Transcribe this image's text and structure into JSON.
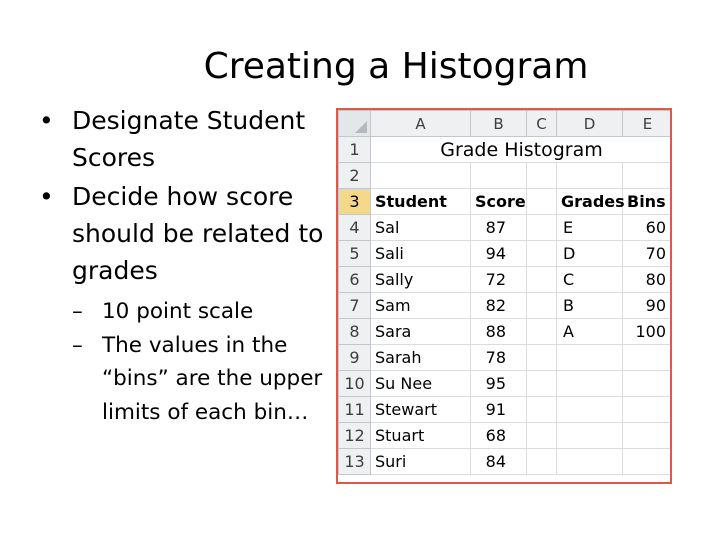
{
  "slide": {
    "title": "Creating a Histogram",
    "bullets": [
      {
        "text": "Designate Student Scores"
      },
      {
        "text": "Decide how score should be related to grades"
      }
    ],
    "sub_bullets": [
      {
        "text": "10 point scale"
      },
      {
        "text": "The values in the “bins” are the upper limits of each bin…"
      }
    ],
    "bullet_mark": "•",
    "sub_bullet_mark": "–"
  },
  "sheet": {
    "columns": [
      "A",
      "B",
      "C",
      "D",
      "E"
    ],
    "title": "Grade Histogram",
    "header_row": {
      "student": "Student",
      "score": "Score",
      "grades": "Grades",
      "bins": "Bins"
    },
    "row_numbers": [
      "1",
      "2",
      "3",
      "4",
      "5",
      "6",
      "7",
      "8",
      "9",
      "10",
      "11",
      "12",
      "13"
    ],
    "active_row": "3",
    "students": [
      {
        "name": "Sal",
        "score": "87"
      },
      {
        "name": "Sali",
        "score": "94"
      },
      {
        "name": "Sally",
        "score": "72"
      },
      {
        "name": "Sam",
        "score": "82"
      },
      {
        "name": "Sara",
        "score": "88"
      },
      {
        "name": "Sarah",
        "score": "78"
      },
      {
        "name": "Su Nee",
        "score": "95"
      },
      {
        "name": "Stewart",
        "score": "91"
      },
      {
        "name": "Stuart",
        "score": "68"
      },
      {
        "name": "Suri",
        "score": "84"
      }
    ],
    "grades": [
      {
        "grade": "E",
        "bin": "60"
      },
      {
        "grade": "D",
        "bin": "70"
      },
      {
        "grade": "C",
        "bin": "80"
      },
      {
        "grade": "B",
        "bin": "90"
      },
      {
        "grade": "A",
        "bin": "100"
      }
    ],
    "colors": {
      "border": "#e0584a",
      "active_row_header": "#f5d98b",
      "header_bg": "#eef0f2"
    }
  }
}
